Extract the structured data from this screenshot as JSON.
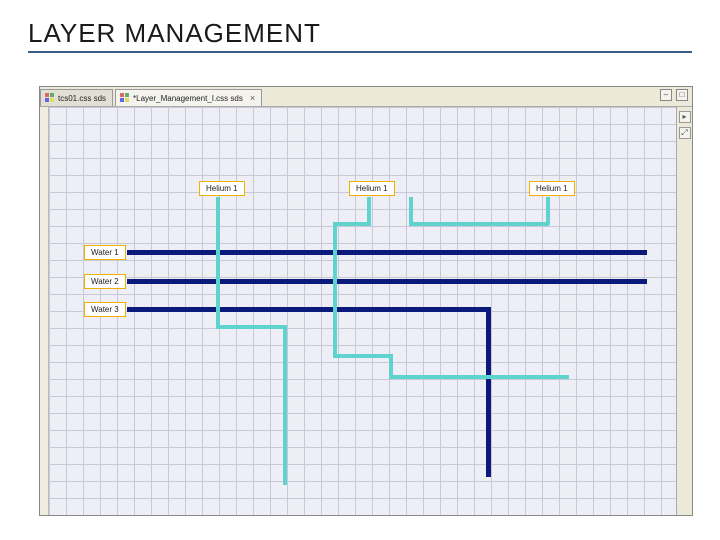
{
  "slide": {
    "title": "LAYER MANAGEMENT"
  },
  "tabs": [
    {
      "label": "tcs01.css sds",
      "active": false
    },
    {
      "label": "*Layer_Management_I.css sds",
      "active": true
    }
  ],
  "nodes": {
    "helium1_a": "Helium 1",
    "helium1_b": "Helium 1",
    "helium1_c": "Helium 1",
    "water1": "Water 1",
    "water2": "Water 2",
    "water3": "Water 3"
  },
  "icons": {
    "close": "×",
    "minimize": "–",
    "maximize": "□",
    "arrow": "▸",
    "zoom": "⤢"
  },
  "colors": {
    "cyan": "#5fd4ce",
    "dark": "#0a1a7a"
  }
}
